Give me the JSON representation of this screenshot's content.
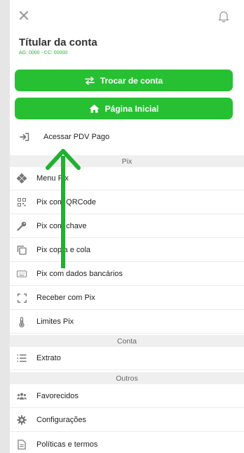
{
  "header": {
    "close_icon": "close-icon",
    "bell_icon": "bell-icon"
  },
  "account": {
    "title": "Títular da conta",
    "details": "AG: 0000 - CC: 00000"
  },
  "buttons": {
    "swap": "Trocar de conta",
    "home": "Página Inicial"
  },
  "pdv": {
    "label": "Acessar PDV Pago"
  },
  "sections": {
    "pix": "Pix",
    "conta": "Conta",
    "outros": "Outros"
  },
  "pix_items": [
    {
      "label": "Menu Pix",
      "icon": "diamond-icon"
    },
    {
      "label": "Pix com QRCode",
      "icon": "qrcode-icon"
    },
    {
      "label": "Pix com chave",
      "icon": "key-icon"
    },
    {
      "label": "Pix copia e cola",
      "icon": "copy-icon"
    },
    {
      "label": "Pix com dados bancários",
      "icon": "keyboard-icon"
    },
    {
      "label": "Receber com Pix",
      "icon": "scan-icon"
    },
    {
      "label": "Limites Pix",
      "icon": "thermometer-icon"
    }
  ],
  "conta_items": [
    {
      "label": "Extrato",
      "icon": "list-icon"
    }
  ],
  "outros_items": [
    {
      "label": "Favorecidos",
      "icon": "users-icon"
    },
    {
      "label": "Configurações",
      "icon": "gear-icon"
    },
    {
      "label": "Políticas e termos",
      "icon": "document-icon"
    }
  ],
  "colors": {
    "accent": "#27c032",
    "annotation_arrow": "#22b030"
  }
}
